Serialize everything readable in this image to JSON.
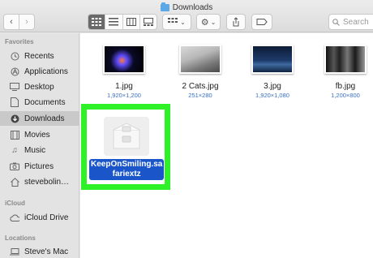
{
  "window": {
    "title": "Downloads"
  },
  "search": {
    "placeholder": "Search"
  },
  "sidebar": {
    "favorites_heading": "Favorites",
    "favorites": [
      {
        "label": "Recents",
        "icon": "clock-icon"
      },
      {
        "label": "Applications",
        "icon": "applications-icon"
      },
      {
        "label": "Desktop",
        "icon": "desktop-icon"
      },
      {
        "label": "Documents",
        "icon": "document-icon"
      },
      {
        "label": "Downloads",
        "icon": "download-icon",
        "selected": true
      },
      {
        "label": "Movies",
        "icon": "film-icon"
      },
      {
        "label": "Music",
        "icon": "music-icon"
      },
      {
        "label": "Pictures",
        "icon": "camera-icon"
      },
      {
        "label": "stevebolin…",
        "icon": "home-icon"
      }
    ],
    "icloud_heading": "iCloud",
    "icloud": [
      {
        "label": "iCloud Drive",
        "icon": "cloud-icon"
      }
    ],
    "locations_heading": "Locations",
    "locations": [
      {
        "label": "Steve's Mac",
        "icon": "laptop-icon"
      }
    ]
  },
  "files": [
    {
      "name": "1.jpg",
      "size": "1,920×1,200"
    },
    {
      "name": "2 Cats.jpg",
      "size": "251×280"
    },
    {
      "name": "3.jpg",
      "size": "1,920×1,080"
    },
    {
      "name": "fb.jpg",
      "size": "1,200×800"
    }
  ],
  "selected_file": {
    "name_line1": "KeepOnSmiling.sa",
    "name_line2": "fariextz",
    "icon": "safari-extension-icon"
  },
  "colors": {
    "highlight": "#2ef227",
    "selection": "#1a56c9",
    "link": "#3a6fc4"
  }
}
